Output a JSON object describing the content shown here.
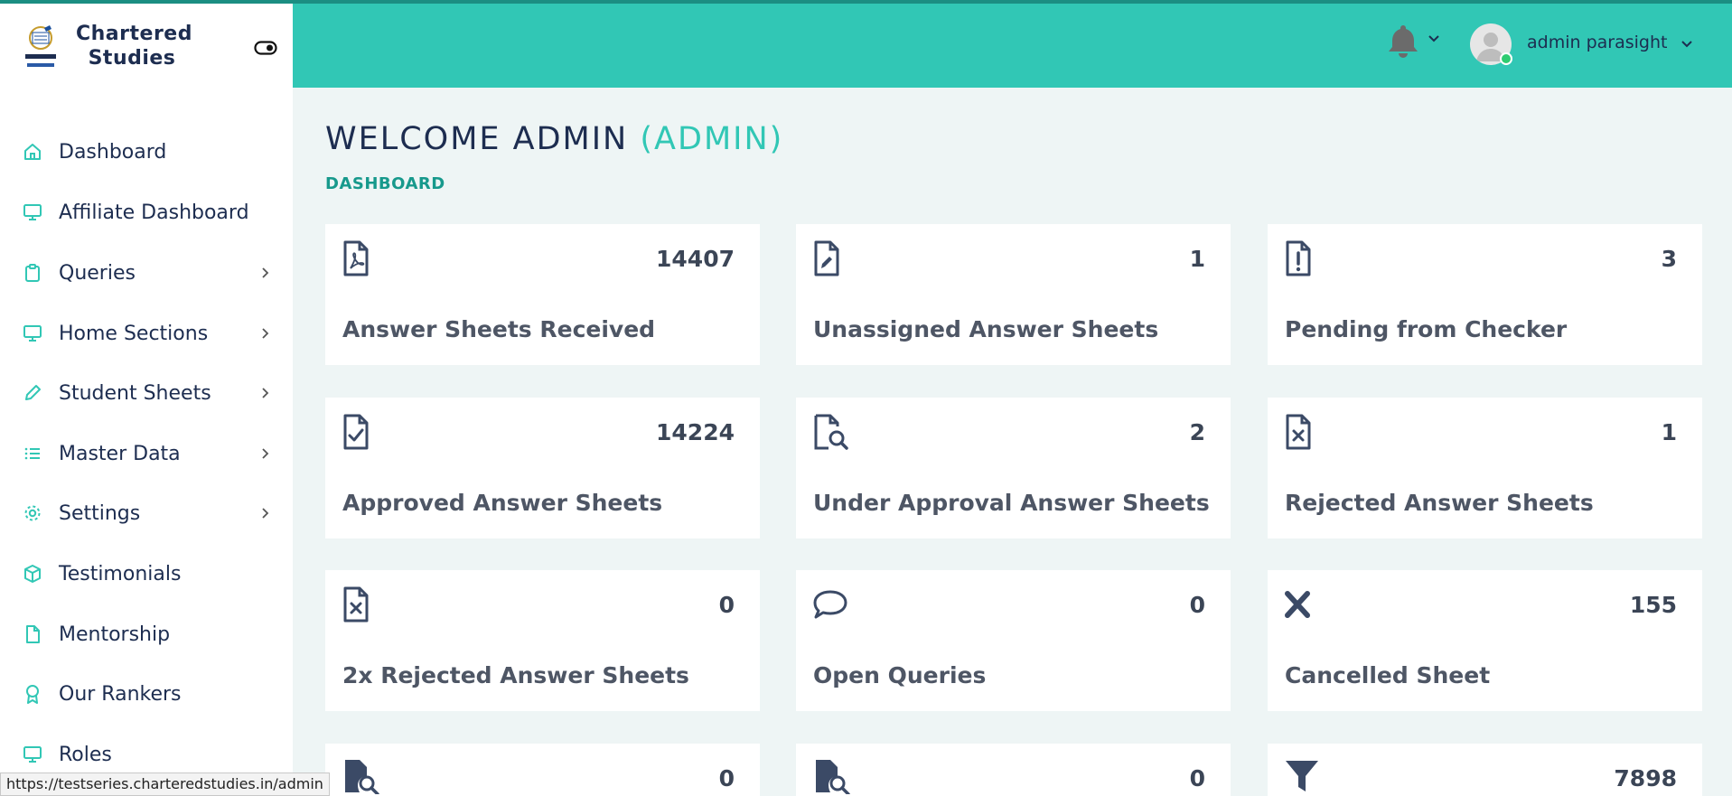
{
  "brand": {
    "name_line1": "Chartered",
    "name_line2": "Studies"
  },
  "header": {
    "username": "admin parasight"
  },
  "sidebar": {
    "items": [
      {
        "label": "Dashboard"
      },
      {
        "label": "Affiliate Dashboard"
      },
      {
        "label": "Queries"
      },
      {
        "label": "Home Sections"
      },
      {
        "label": "Student Sheets"
      },
      {
        "label": "Master Data"
      },
      {
        "label": "Settings"
      },
      {
        "label": "Testimonials"
      },
      {
        "label": "Mentorship"
      },
      {
        "label": "Our Rankers"
      },
      {
        "label": "Roles"
      }
    ]
  },
  "main": {
    "title": "WELCOME ADMIN",
    "role": "(ADMIN)",
    "breadcrumb": "DASHBOARD"
  },
  "cards": [
    {
      "value": "14407",
      "label": "Answer Sheets Received",
      "icon": "file-pdf-icon"
    },
    {
      "value": "1",
      "label": "Unassigned Answer Sheets",
      "icon": "file-edit-icon"
    },
    {
      "value": "3",
      "label": "Pending from Checker",
      "icon": "file-exclamation-icon"
    },
    {
      "value": "14224",
      "label": "Approved Answer Sheets",
      "icon": "file-check-icon"
    },
    {
      "value": "2",
      "label": "Under Approval Answer Sheets",
      "icon": "file-search-icon"
    },
    {
      "value": "1",
      "label": "Rejected Answer Sheets",
      "icon": "file-x-icon"
    },
    {
      "value": "0",
      "label": "2x Rejected Answer Sheets",
      "icon": "file-x-icon"
    },
    {
      "value": "0",
      "label": "Open Queries",
      "icon": "chat-bubble-icon"
    },
    {
      "value": "155",
      "label": "Cancelled Sheet",
      "icon": "x-mark-icon"
    },
    {
      "value": "0",
      "label": "",
      "icon": "file-search-solid-icon"
    },
    {
      "value": "0",
      "label": "",
      "icon": "file-search-solid-icon"
    },
    {
      "value": "7898",
      "label": "",
      "icon": "filter-icon"
    }
  ],
  "statusbar": {
    "url": "https://testseries.charteredstudies.in/admin"
  },
  "colors": {
    "accent": "#31c7b5",
    "navy": "#1d2d50",
    "background": "#eef5f5"
  }
}
